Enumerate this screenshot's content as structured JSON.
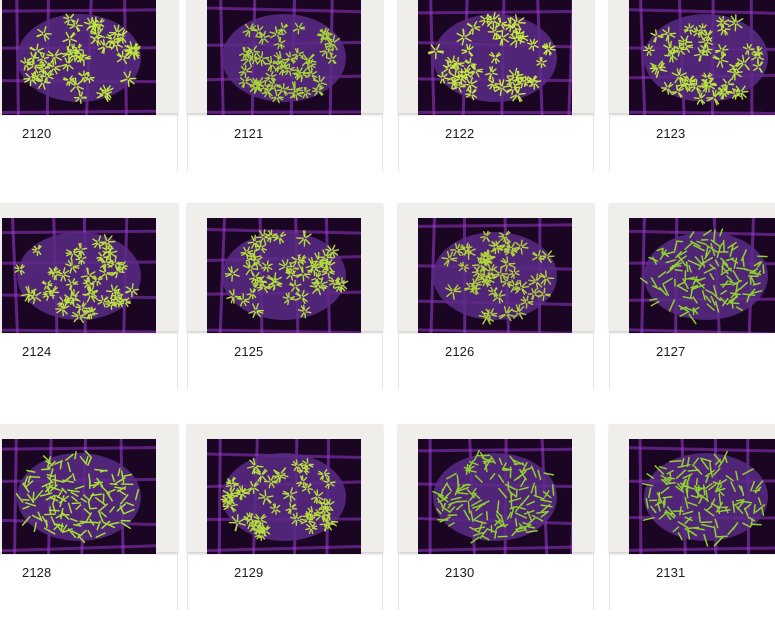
{
  "gallery": {
    "items": [
      {
        "label": "2120",
        "coral": "star-polyp",
        "tone": "#bde93a"
      },
      {
        "label": "2121",
        "coral": "star-polyp",
        "tone": "#a6d636"
      },
      {
        "label": "2122",
        "coral": "star-polyp",
        "tone": "#c2ea3c"
      },
      {
        "label": "2123",
        "coral": "star-polyp",
        "tone": "#b6e43a"
      },
      {
        "label": "2124",
        "coral": "star-polyp",
        "tone": "#b9e23c"
      },
      {
        "label": "2125",
        "coral": "star-polyp",
        "tone": "#b2df3a"
      },
      {
        "label": "2126",
        "coral": "star-polyp",
        "tone": "#aed238"
      },
      {
        "label": "2127",
        "coral": "green-star-polyp",
        "tone": "#8fd22c"
      },
      {
        "label": "2128",
        "coral": "green-star-polyp",
        "tone": "#a5e032"
      },
      {
        "label": "2129",
        "coral": "star-polyp",
        "tone": "#b5df3b"
      },
      {
        "label": "2130",
        "coral": "green-star-polyp",
        "tone": "#8fd02c"
      },
      {
        "label": "2131",
        "coral": "green-star-polyp",
        "tone": "#8fd22c"
      }
    ]
  },
  "colors": {
    "background": "#ffffff",
    "frame": "#efeeea",
    "photo_background": "#1a0622",
    "grid_glow": "#9d3bd6"
  }
}
